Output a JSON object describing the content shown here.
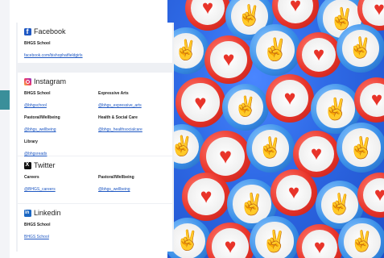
{
  "facebook": {
    "heading": "Facebook",
    "icon": "facebook-icon",
    "entries": [
      {
        "label": "BHGS School",
        "link": "facebook.com/bishophatfieldgirls"
      }
    ]
  },
  "instagram": {
    "heading": "Instagram",
    "icon": "instagram-icon",
    "entries": [
      {
        "label": "BHGS School",
        "link": "@bhgschool"
      },
      {
        "label": "Expressive Arts",
        "link": "@bhgs_expressive_arts"
      },
      {
        "label": "Pastoral/Wellbeing",
        "link": "@bhgs_wellbeing"
      },
      {
        "label": "Health & Social Care",
        "link": "@bhgs_healthsocialcare"
      },
      {
        "label": "Library",
        "link": "@bhgsreads"
      }
    ]
  },
  "twitter": {
    "heading": "Twitter",
    "icon": "x-twitter-icon",
    "entries": [
      {
        "label": "Careers",
        "link": "@BHGS_careers"
      },
      {
        "label": "Pastoral/Wellbeing",
        "link": "@bhgs_wellbeing"
      }
    ]
  },
  "linkedin": {
    "heading": "Linkedin",
    "icon": "linkedin-icon",
    "entries": [
      {
        "label": "BHGS School",
        "link": "BHGS School"
      }
    ]
  },
  "hero": {
    "icons": [
      "heart-icon",
      "thumbs-up-icon"
    ],
    "colors": {
      "red": "#e8342a",
      "blue": "#3a8fe8",
      "background": "#2f6ae6"
    }
  },
  "left_strip": {
    "accent": "#3a8f9a"
  }
}
